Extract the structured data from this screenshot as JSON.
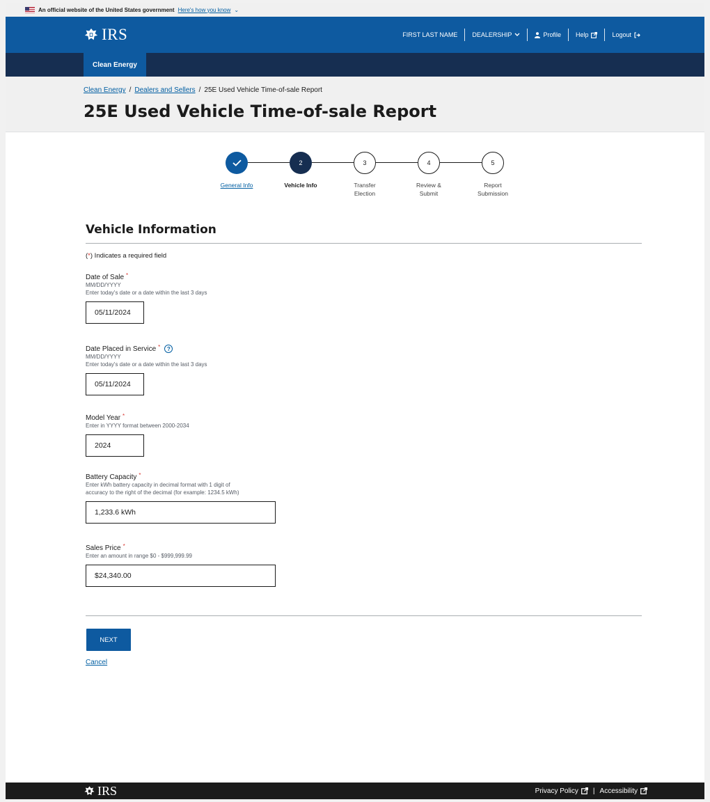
{
  "gov_banner": {
    "text": "An official website of the United States government",
    "link": "Here's how you know"
  },
  "header": {
    "logo_text": "IRS",
    "user_name": "FIRST LAST NAME",
    "dealership": "DEALERSHIP",
    "profile": "Profile",
    "help": "Help",
    "logout": "Logout"
  },
  "subnav": {
    "active_tab": "Clean Energy"
  },
  "breadcrumb": {
    "items": [
      "Clean Energy",
      "Dealers and Sellers"
    ],
    "current": "25E Used Vehicle Time-of-sale Report",
    "separator": "/"
  },
  "page_title": "25E Used Vehicle Time-of-sale Report",
  "stepper": {
    "steps": [
      {
        "number": "",
        "line1": "General Info",
        "line2": "",
        "status": "complete"
      },
      {
        "number": "2",
        "line1": "Vehicle Info",
        "line2": "",
        "status": "current"
      },
      {
        "number": "3",
        "line1": "Transfer",
        "line2": "Election",
        "status": "upcoming"
      },
      {
        "number": "4",
        "line1": "Review &",
        "line2": "Submit",
        "status": "upcoming"
      },
      {
        "number": "5",
        "line1": "Report",
        "line2": "Submission",
        "status": "upcoming"
      }
    ]
  },
  "form": {
    "section_title": "Vehicle Information",
    "required_note": {
      "open": "(",
      "star": "*",
      "close": ") Indicates a required field"
    },
    "required_marker": "*",
    "fields": {
      "date_of_sale": {
        "label": "Date of Sale",
        "hint1": "MM/DD/YYYY",
        "hint2": "Enter today's date or a date within the last 3 days",
        "value": "05/11/2024"
      },
      "date_in_service": {
        "label": "Date Placed in Service",
        "hint1": "MM/DD/YYYY",
        "hint2": "Enter today's date or a date within the last 3 days",
        "value": "05/11/2024",
        "help_icon": "?"
      },
      "model_year": {
        "label": "Model Year",
        "hint1": "Enter in YYYY format between 2000-2034",
        "value": "2024"
      },
      "battery_capacity": {
        "label": "Battery Capacity",
        "hint1": "Enter kWh battery capacity in decimal format with 1 digit of",
        "hint2": "accuracy to the right of the decimal (for example: 1234.5 kWh)",
        "value": "1,233.6 kWh"
      },
      "sales_price": {
        "label": "Sales Price",
        "hint1": "Enter an amount in range $0 - $999,999.99",
        "value": "$24,340.00"
      }
    },
    "next_label": "NEXT",
    "cancel_label": "Cancel"
  },
  "footer": {
    "logo_text": "IRS",
    "privacy": "Privacy Policy",
    "separator": "|",
    "accessibility": "Accessibility"
  },
  "colors": {
    "primary_blue": "#0e5aa0",
    "navy": "#162e51",
    "link": "#005ea2",
    "required": "#d83933",
    "footer_bg": "#1b1b1b"
  }
}
